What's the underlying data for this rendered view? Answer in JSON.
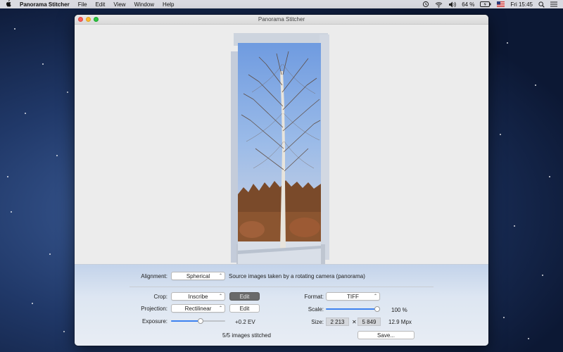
{
  "menubar": {
    "app_name": "Panorama Stitcher",
    "menus": [
      "File",
      "Edit",
      "View",
      "Window"
    ],
    "help": "Help",
    "battery": "64 %",
    "clock": "Fri 15:45",
    "icons": [
      "apple-icon",
      "time-machine-icon",
      "wifi-icon",
      "volume-icon",
      "battery-icon",
      "flag-icon",
      "search-icon",
      "menu-list-icon"
    ]
  },
  "window": {
    "title": "Panorama Stitcher"
  },
  "controls": {
    "alignment_label": "Alignment:",
    "alignment_value": "Spherical",
    "alignment_description": "Source images taken by a rotating camera (panorama)",
    "crop_label": "Crop:",
    "crop_value": "Inscribe",
    "crop_edit": "Edit",
    "projection_label": "Projection:",
    "projection_value": "Rectilinear",
    "projection_edit": "Edit",
    "exposure_label": "Exposure:",
    "exposure_value": "+0.2 EV",
    "exposure_slider_fraction": 0.55,
    "format_label": "Format:",
    "format_value": "TIFF",
    "scale_label": "Scale:",
    "scale_value": "100 %",
    "scale_slider_fraction": 1.0,
    "size_label": "Size:",
    "size_width": "2 213",
    "size_times": "✕",
    "size_height": "5 849",
    "size_mpx": "12.9 Mpx",
    "status": "5/5 images stitched",
    "save_button": "Save..."
  },
  "colors": {
    "accent": "#3d82f0",
    "close": "#fc5f57",
    "minimize": "#fdbc2e",
    "maximize": "#2bc840"
  }
}
